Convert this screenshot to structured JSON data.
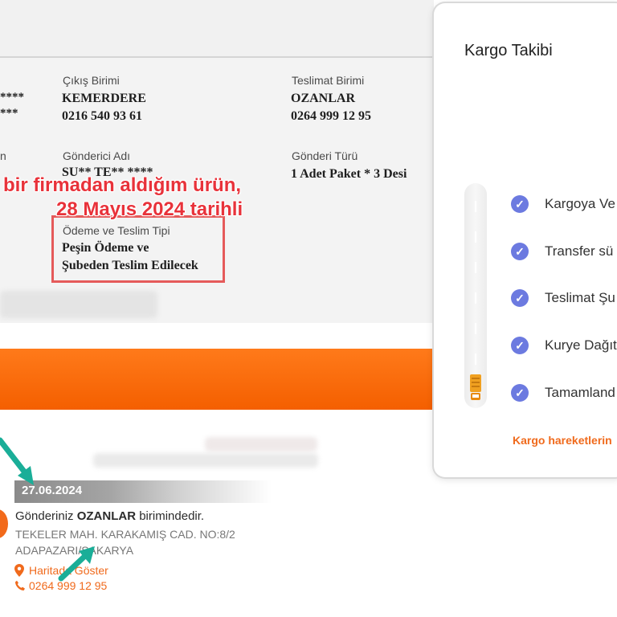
{
  "shipment": {
    "masked_left_1": "****",
    "masked_left_2": "***",
    "cut_label": "n",
    "cikis_birimi_label": "Çıkış Birimi",
    "cikis_birimi_value": "KEMERDERE",
    "cikis_phone": "0216 540 93 61",
    "teslimat_birimi_label": "Teslimat Birimi",
    "teslimat_birimi_value": "OZANLAR",
    "teslimat_phone": "0264 999 12 95",
    "gonderici_adi_label": "Gönderici Adı",
    "gonderici_adi_value": "SU** TE** ****",
    "gonderi_turu_label": "Gönderi Türü",
    "gonderi_turu_value": "1 Adet Paket * 3 Desi",
    "odeme_label": "Ödeme ve Teslim Tipi",
    "odeme_value_line1": "Peşin Ödeme ve",
    "odeme_value_line2": "Şubeden Teslim Edilecek"
  },
  "annotation": {
    "line1": "bir firmadan aldığım ürün,",
    "line2": "28 Mayıs 2024 tarihli"
  },
  "modal": {
    "title": "Kargo Takibi",
    "steps": [
      {
        "label": "Kargoya Ve"
      },
      {
        "label": "Transfer sü"
      },
      {
        "label": "Teslimat Şu"
      },
      {
        "label": "Kurye Dağıt"
      },
      {
        "label": "Tamamland"
      }
    ],
    "link": "Kargo hareketlerin"
  },
  "timeline": {
    "date": "27.06.2024",
    "message_prefix": "Gönderiniz ",
    "message_bold": "OZANLAR",
    "message_suffix": " birimindedir.",
    "address_line1": "TEKELER MAH. KARAKAMIŞ CAD. NO:8/2",
    "address_line2": "ADAPAZARI/SAKARYA",
    "map_link": "Haritada Göster",
    "phone": "0264 999 12 95"
  },
  "colors": {
    "orange": "#f06a1c",
    "check_blue": "#6c7ae0",
    "annotation_red": "#e8323a",
    "arrow_teal": "#1aae98"
  },
  "icons": {
    "check": "check-icon",
    "pin": "map-pin-icon",
    "phone": "phone-icon",
    "truck": "truck-icon"
  }
}
